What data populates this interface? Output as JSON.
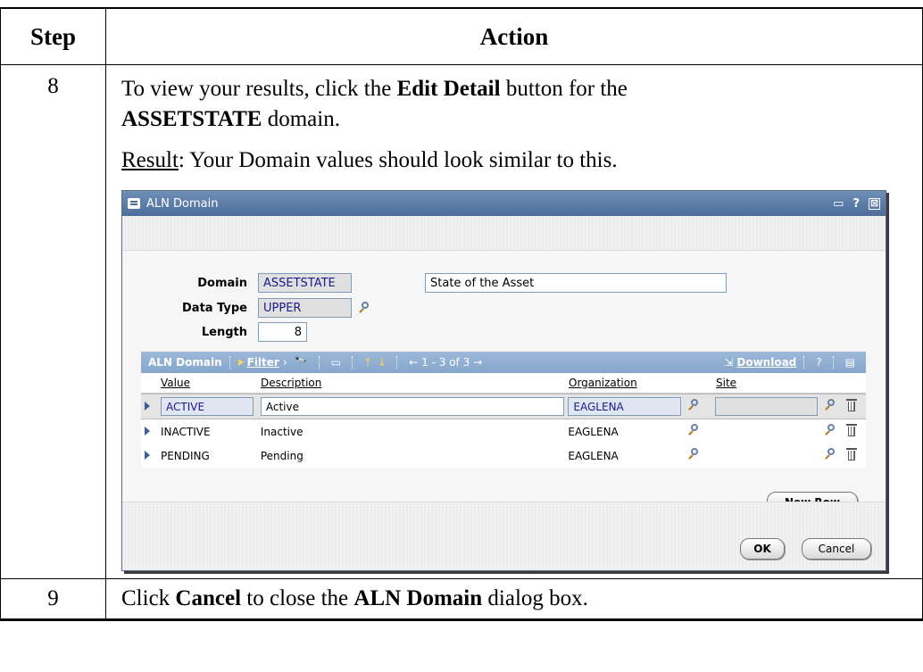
{
  "doc": {
    "header_step": "Step",
    "header_action": "Action",
    "step8": {
      "number": "8",
      "text1": "To view your results, click the ",
      "bold1": "Edit Detail",
      "text2": " button for the",
      "bold2": "ASSETSTATE",
      "text3": " domain.",
      "result_label": "Result",
      "result_text": ": Your Domain values should look similar to this."
    },
    "step9": {
      "number": "9",
      "text1": "Click ",
      "bold1": "Cancel",
      "text2": " to close the ",
      "bold2": "ALN Domain",
      "text3": " dialog box."
    }
  },
  "dialog": {
    "title": "ALN Domain",
    "title_icons": [
      "layout-icon",
      "help-icon",
      "close-icon"
    ],
    "help_glyph": "?",
    "close_glyph": "⊠",
    "domain_label": "Domain",
    "domain_value": "ASSETSTATE",
    "domain_description": "State of the Asset",
    "datatype_label": "Data Type",
    "datatype_value": "UPPER",
    "length_label": "Length",
    "length_value": "8",
    "table": {
      "title": "ALN Domain",
      "filter_label": "Filter",
      "binoculars_glyph": "🔭",
      "pager_text": "1 - 3 of 3",
      "download_label": "Download",
      "help_glyph": "?",
      "columns": [
        "Value",
        "Description",
        "Organization",
        "Site"
      ],
      "rows": [
        {
          "value": "ACTIVE",
          "description": "Active",
          "organization": "EAGLENA",
          "site": ""
        },
        {
          "value": "INACTIVE",
          "description": "Inactive",
          "organization": "EAGLENA",
          "site": ""
        },
        {
          "value": "PENDING",
          "description": "Pending",
          "organization": "EAGLENA",
          "site": ""
        }
      ],
      "new_row_label": "New Row"
    },
    "ok_label": "OK",
    "cancel_label": "Cancel"
  }
}
